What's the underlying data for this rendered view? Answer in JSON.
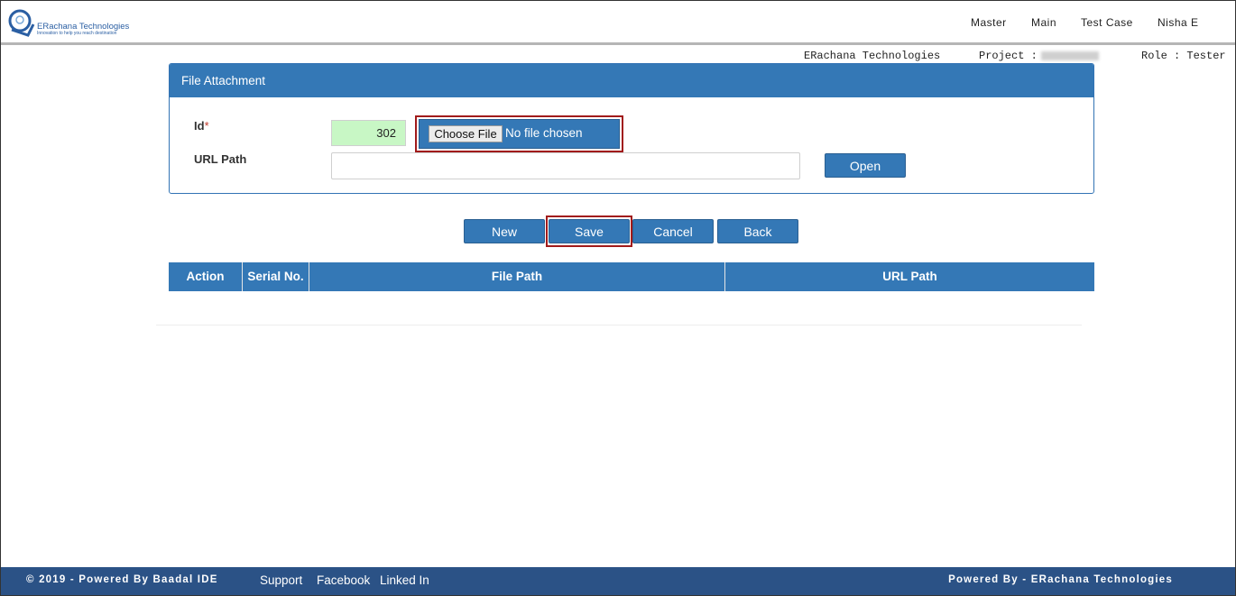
{
  "brand": {
    "name": "ERachana Technologies",
    "tagline": "Innovation to help you reach destination"
  },
  "nav": {
    "master": "Master",
    "main": "Main",
    "test_case": "Test Case",
    "user": "Nisha E"
  },
  "info_bar": {
    "company": "ERachana Technologies",
    "project_label": "Project :",
    "role": "Role : Tester"
  },
  "form": {
    "title": "File Attachment",
    "id_label": "Id",
    "required_mark": "*",
    "id_value": "302",
    "choose_file_label": "Choose File",
    "no_file_text": "No file chosen",
    "url_label": "URL Path",
    "url_value": "",
    "open_label": "Open"
  },
  "actions": {
    "new": "New",
    "save": "Save",
    "cancel": "Cancel",
    "back": "Back"
  },
  "table": {
    "columns": [
      "Action",
      "Serial No.",
      "File Path",
      "URL Path"
    ],
    "rows": []
  },
  "footer": {
    "copyright": "© 2019 - Powered By Baadal IDE",
    "links": [
      "Support",
      "Facebook",
      "Linked In"
    ],
    "powered_by": "Powered By - ERachana Technologies"
  },
  "colors": {
    "primary": "#3478b6",
    "footer": "#2b5286",
    "highlight_border": "#a11b1b",
    "id_field_bg": "#c8f7c5"
  }
}
